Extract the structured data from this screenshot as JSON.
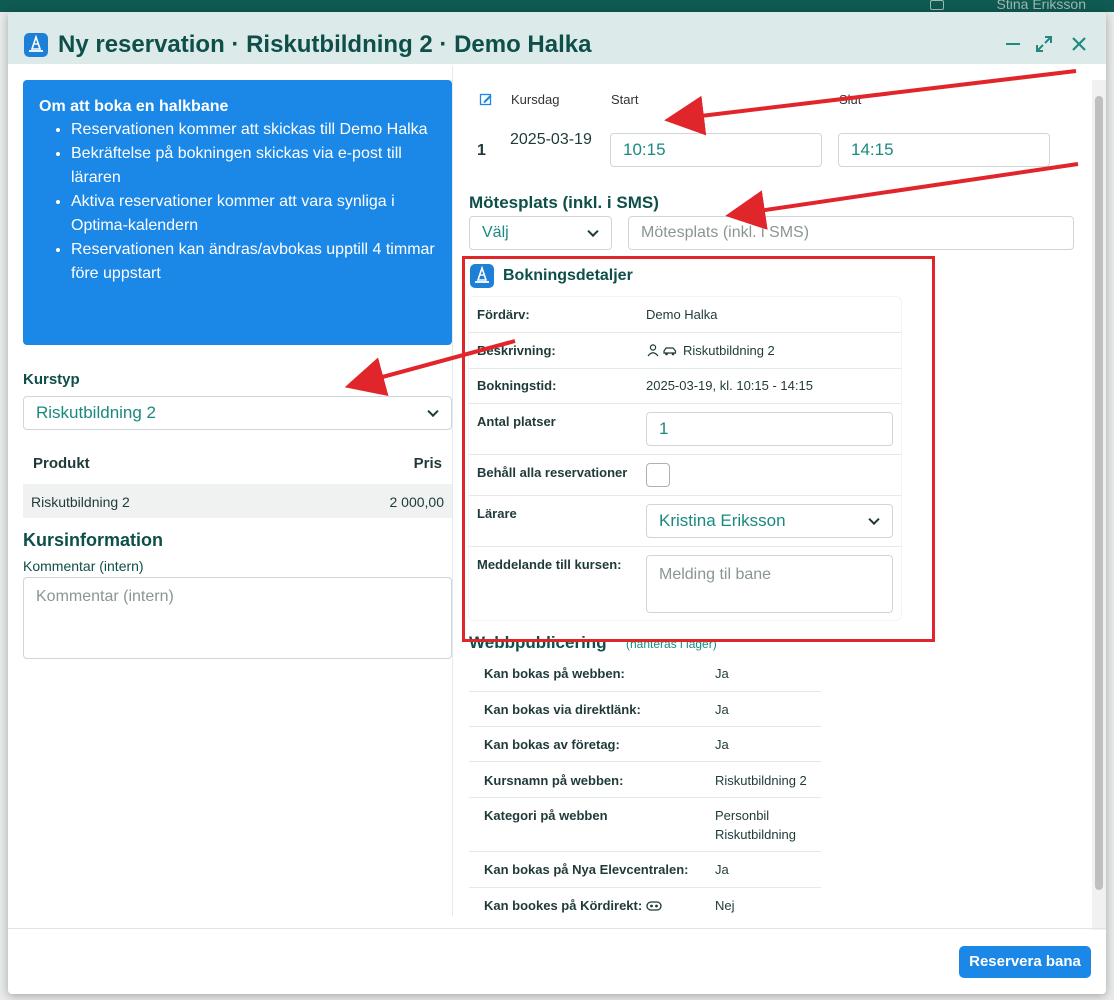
{
  "background": {
    "user_name": "Stina Eriksson"
  },
  "modal": {
    "title": "Ny reservation · Riskutbildning 2 · Demo Halka",
    "minimize_icon": "minimize-icon",
    "expand_icon": "expand-icon",
    "close_icon": "close-icon"
  },
  "info": {
    "title": "Om att boka en halkbane",
    "items": [
      "Reservationen kommer att skickas till Demo Halka",
      "Bekräftelse på bokningen skickas via e-post till läraren",
      "Aktiva reservationer kommer att vara synliga i Optima-kalendern",
      "Reservationen kan ändras/avbokas upptill 4 timmar före uppstart"
    ]
  },
  "kurstyp": {
    "label": "Kurstyp",
    "selected": "Riskutbildning 2"
  },
  "products": {
    "headers": {
      "product": "Produkt",
      "price": "Pris"
    },
    "rows": [
      {
        "name": "Riskutbildning 2",
        "price": "2 000,00"
      }
    ]
  },
  "kursinfo": {
    "title": "Kursinformation",
    "comment_label": "Kommentar (intern)",
    "comment_placeholder": "Kommentar (intern)"
  },
  "course_days": {
    "headers": {
      "day": "Kursdag",
      "start": "Start",
      "end": "Slut"
    },
    "rows": [
      {
        "num": "1",
        "date": "2025-03-19",
        "start": "10:15",
        "end": "14:15"
      }
    ]
  },
  "meeting": {
    "title": "Mötesplats (inkl. i SMS)",
    "select": "Välj",
    "placeholder": "Mötesplats (inkl. i SMS)"
  },
  "booking": {
    "title": "Bokningsdetaljer",
    "rows": {
      "provider": {
        "label": "Fördärv:",
        "value": "Demo Halka"
      },
      "description": {
        "label": "Beskrivning:",
        "value": "Riskutbildning 2"
      },
      "time": {
        "label": "Bokningstid:",
        "value": "2025-03-19, kl. 10:15 - 14:15"
      },
      "seats": {
        "label": "Antal platser",
        "value": "1"
      },
      "keep": {
        "label": "Behåll alla reservationer"
      },
      "teacher": {
        "label": "Lärare",
        "value": "Kristina Eriksson"
      },
      "message": {
        "label": "Meddelande till kursen:",
        "placeholder": "Melding til bane"
      }
    }
  },
  "web": {
    "title": "Webbpublicering",
    "subtitle": "(hanteras i lager)",
    "rows": [
      {
        "label": "Kan bokas på webben:",
        "value": "Ja"
      },
      {
        "label": "Kan bokas via direktlänk:",
        "value": "Ja"
      },
      {
        "label": "Kan bokas av företag:",
        "value": "Ja"
      },
      {
        "label": "Kursnamn på webben:",
        "value": "Riskutbildning 2"
      },
      {
        "label": "Kategori på webben",
        "value": "Personbil",
        "value2": "Riskutbildning"
      },
      {
        "label": "Kan bokas på Nya Elevcentralen:",
        "value": "Ja"
      },
      {
        "label": "Kan bookes på Kördirekt:",
        "value": "Nej"
      }
    ]
  },
  "footer": {
    "reserve_button": "Reservera bana"
  },
  "colors": {
    "accent": "#1b87e6",
    "heading": "#0f4f4a",
    "annotation": "#e0262b"
  }
}
